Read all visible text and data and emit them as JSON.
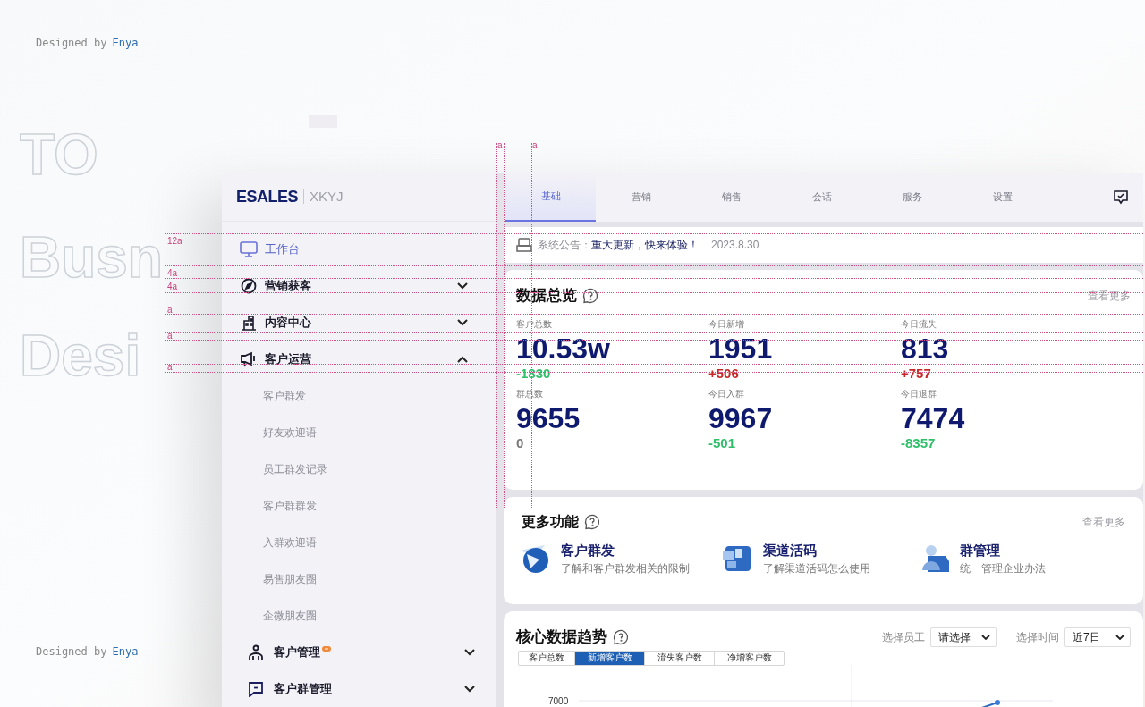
{
  "credits": [
    {
      "prefix": "Designed by",
      "author": "Enya"
    },
    {
      "prefix": "Designed by",
      "author": "Enya"
    }
  ],
  "backdrop_words": [
    "TO",
    "Busn",
    "Desi"
  ],
  "spacing_marks": {
    "horizontal": [
      "12a",
      "4a",
      "4a",
      "a",
      "a",
      "a"
    ],
    "vertical": [
      "a",
      "a"
    ]
  },
  "app": {
    "logo": "ESALES",
    "logo_sub": "XKYJ",
    "sidebar": [
      {
        "kind": "link",
        "label": "工作台",
        "selected": true,
        "badge": false
      },
      {
        "kind": "group",
        "label": "营销获客",
        "selected": false,
        "expanded": false,
        "badge": false
      },
      {
        "kind": "group",
        "label": "内容中心",
        "selected": false,
        "expanded": false,
        "badge": false
      },
      {
        "kind": "group",
        "label": "客户运营",
        "selected": false,
        "expanded": true,
        "badge": false,
        "children": [
          {
            "label": "客户群发",
            "selected": false
          },
          {
            "label": "好友欢迎语",
            "selected": false
          },
          {
            "label": "员工群发记录",
            "selected": false
          },
          {
            "label": "客户群群发",
            "selected": false
          },
          {
            "label": "入群欢迎语",
            "selected": false
          },
          {
            "label": "易售朋友圈",
            "selected": false
          },
          {
            "label": "企微朋友圈",
            "selected": false
          }
        ]
      },
      {
        "kind": "group",
        "label": "客户管理",
        "selected": false,
        "expanded": false,
        "badge": true
      },
      {
        "kind": "group",
        "label": "客户群管理",
        "selected": false,
        "expanded": false,
        "badge": false
      }
    ],
    "tabs": [
      {
        "label": "基础",
        "selected": true
      },
      {
        "label": "营销",
        "selected": false
      },
      {
        "label": "销售",
        "selected": false
      },
      {
        "label": "会话",
        "selected": false
      },
      {
        "label": "服务",
        "selected": false
      },
      {
        "label": "设置",
        "selected": false
      }
    ],
    "notice": {
      "label": "系统公告：",
      "message": "重大更新，快来体验！",
      "date": "2023.8.30"
    },
    "overview": {
      "title": "数据总览",
      "more": "查看更多",
      "stats": [
        {
          "label": "客户总数",
          "value": "10.53w",
          "delta": "-1830",
          "color": "#2fbf6a"
        },
        {
          "label": "今日新增",
          "value": "1951",
          "delta": "+506",
          "color": "#c62828"
        },
        {
          "label": "今日流失",
          "value": "813",
          "delta": "+757",
          "color": "#c62828"
        },
        {
          "label": "群总数",
          "value": "9655",
          "delta": "0",
          "color": "#777777"
        },
        {
          "label": "今日入群",
          "value": "9967",
          "delta": "-501",
          "color": "#2fbf6a"
        },
        {
          "label": "今日退群",
          "value": "7474",
          "delta": "-8357",
          "color": "#2fbf6a"
        }
      ]
    },
    "features": {
      "title": "更多功能",
      "more": "查看更多",
      "items": [
        {
          "title": "客户群发",
          "description": "了解和客户群发相关的限制"
        },
        {
          "title": "渠道活码",
          "description": "了解渠道活码怎么使用"
        },
        {
          "title": "群管理",
          "description": "统一管理企业办法"
        }
      ]
    },
    "trend": {
      "title": "核心数据趋势",
      "employee_label": "选择员工",
      "employee_value": "请选择",
      "time_label": "选择时间",
      "time_value": "近7日",
      "segments": [
        {
          "label": "客户总数",
          "selected": false
        },
        {
          "label": "新增客户数",
          "selected": true
        },
        {
          "label": "流失客户数",
          "selected": false
        },
        {
          "label": "净增客户数",
          "selected": false
        }
      ],
      "y_tick": "7000"
    }
  }
}
